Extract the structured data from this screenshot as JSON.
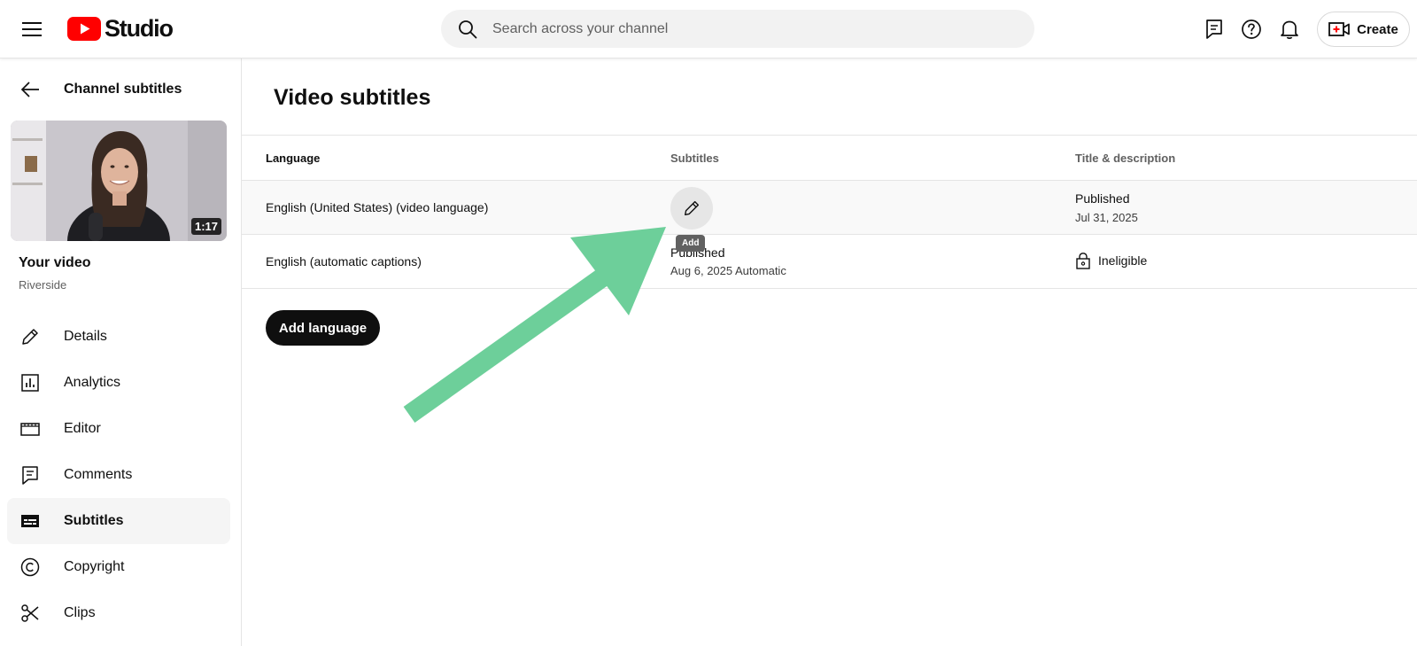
{
  "header": {
    "logo_text": "Studio",
    "search_placeholder": "Search across your channel",
    "create_label": "Create"
  },
  "sidebar": {
    "back_label": "Channel subtitles",
    "video": {
      "duration": "1:17",
      "title": "Your video",
      "channel": "Riverside"
    },
    "items": [
      {
        "label": "Details",
        "icon": "pencil-icon"
      },
      {
        "label": "Analytics",
        "icon": "analytics-icon"
      },
      {
        "label": "Editor",
        "icon": "editor-icon"
      },
      {
        "label": "Comments",
        "icon": "comments-icon"
      },
      {
        "label": "Subtitles",
        "icon": "subtitles-icon",
        "active": true
      },
      {
        "label": "Copyright",
        "icon": "copyright-icon"
      },
      {
        "label": "Clips",
        "icon": "scissors-icon"
      }
    ]
  },
  "main": {
    "title": "Video subtitles",
    "columns": [
      "Language",
      "Subtitles",
      "Title & description"
    ],
    "rows": [
      {
        "language": "English (United States) (video language)",
        "subtitles_tooltip": "Add",
        "title_status": "Published",
        "title_date": "Jul 31, 2025"
      },
      {
        "language": "English (automatic captions)",
        "subtitles_status": "Published",
        "subtitles_date": "Aug 6, 2025 Automatic",
        "title_status": "Ineligible"
      }
    ],
    "add_language_label": "Add language"
  },
  "colors": {
    "brand_red": "#ff0000",
    "annotation_arrow": "#6dcf9a",
    "primary_button": "#0f0f0f"
  }
}
